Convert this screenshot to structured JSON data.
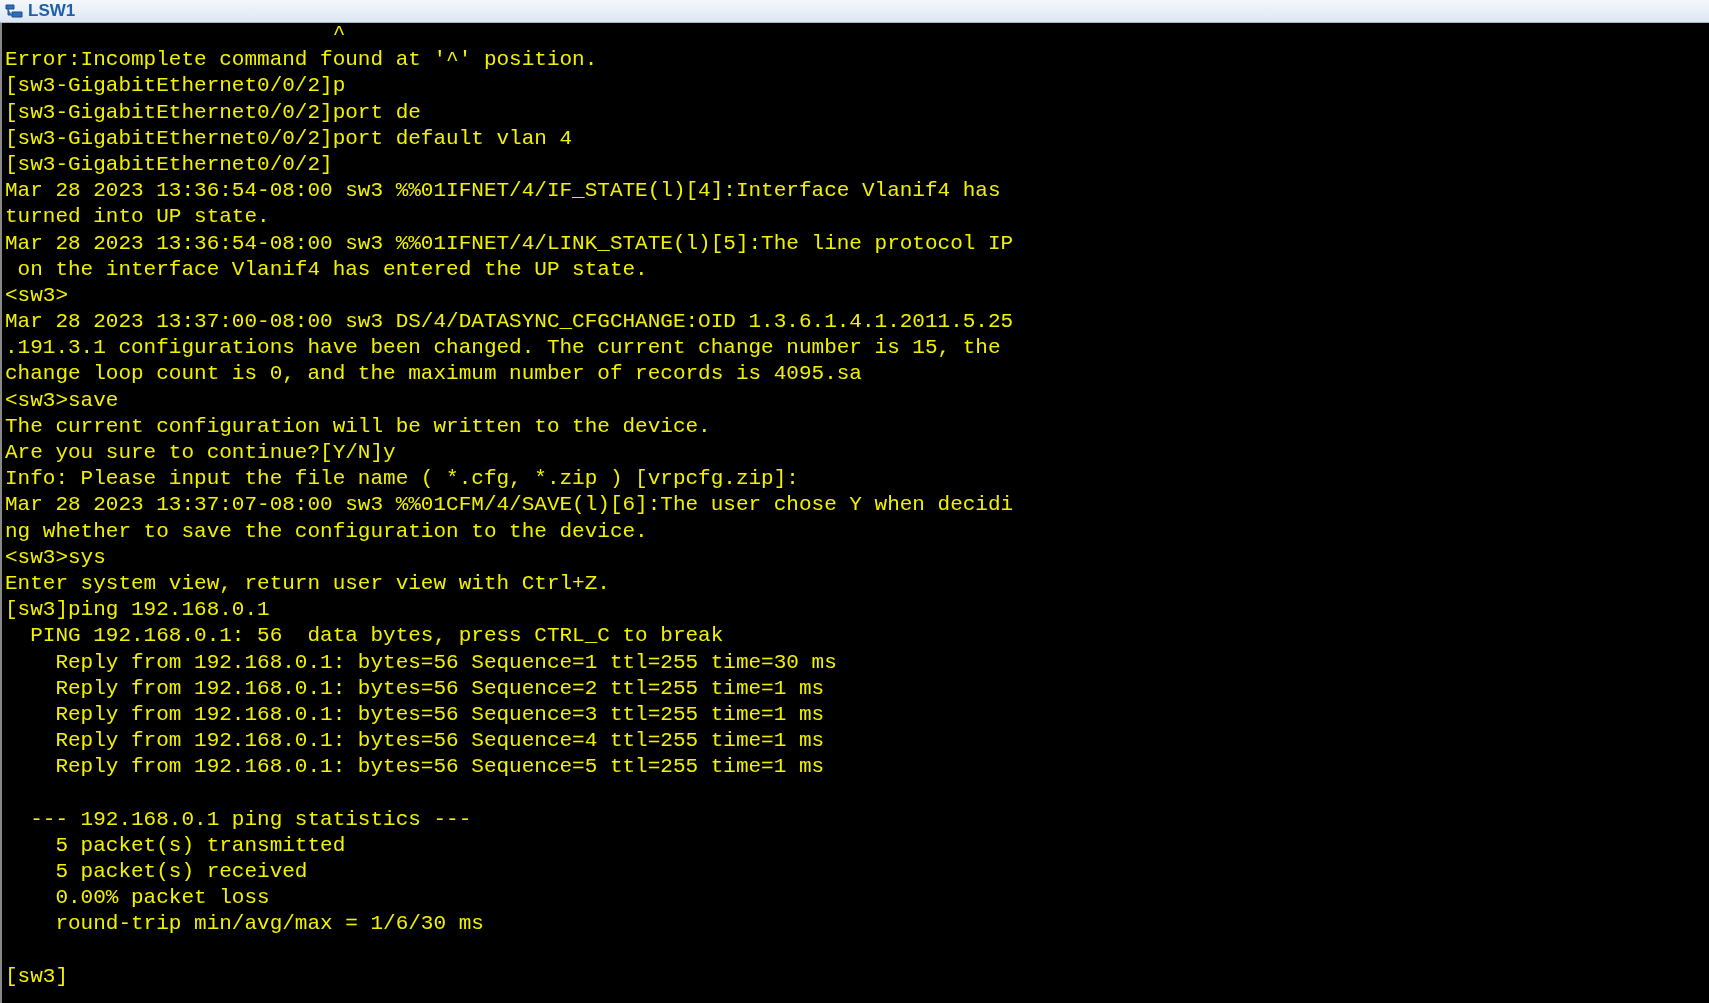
{
  "window": {
    "title": "LSW1"
  },
  "terminal": {
    "lines": [
      {
        "kind": "text",
        "text": "                          ^"
      },
      {
        "kind": "text",
        "text": "Error:Incomplete command found at '^' position."
      },
      {
        "kind": "text",
        "text": "[sw3-GigabitEthernet0/0/2]p"
      },
      {
        "kind": "text",
        "text": "[sw3-GigabitEthernet0/0/2]port de"
      },
      {
        "kind": "text",
        "text": "[sw3-GigabitEthernet0/0/2]port default vlan 4"
      },
      {
        "kind": "text",
        "text": "[sw3-GigabitEthernet0/0/2]"
      },
      {
        "kind": "text",
        "text": "Mar 28 2023 13:36:54-08:00 sw3 %%01IFNET/4/IF_STATE(l)[4]:Interface Vlanif4 has"
      },
      {
        "kind": "text",
        "text": "turned into UP state."
      },
      {
        "kind": "text",
        "text": "Mar 28 2023 13:36:54-08:00 sw3 %%01IFNET/4/LINK_STATE(l)[5]:The line protocol IP"
      },
      {
        "kind": "text",
        "text": " on the interface Vlanif4 has entered the UP state."
      },
      {
        "kind": "text",
        "text": "<sw3>"
      },
      {
        "kind": "text",
        "text": "Mar 28 2023 13:37:00-08:00 sw3 DS/4/DATASYNC_CFGCHANGE:OID 1.3.6.1.4.1.2011.5.25"
      },
      {
        "kind": "text",
        "text": ".191.3.1 configurations have been changed. The current change number is 15, the"
      },
      {
        "kind": "text",
        "text": "change loop count is 0, and the maximum number of records is 4095.sa"
      },
      {
        "kind": "text",
        "text": "<sw3>save"
      },
      {
        "kind": "text",
        "text": "The current configuration will be written to the device."
      },
      {
        "kind": "text",
        "text": "Are you sure to continue?[Y/N]y"
      },
      {
        "kind": "text",
        "text": "Info: Please input the file name ( *.cfg, *.zip ) [vrpcfg.zip]:"
      },
      {
        "kind": "text",
        "text": "Mar 28 2023 13:37:07-08:00 sw3 %%01CFM/4/SAVE(l)[6]:The user chose Y when decidi"
      },
      {
        "kind": "text",
        "text": "ng whether to save the configuration to the device."
      },
      {
        "kind": "text",
        "text": "<sw3>sys"
      },
      {
        "kind": "text",
        "text": "Enter system view, return user view with Ctrl+Z."
      },
      {
        "kind": "text",
        "text": "[sw3]ping 192.168.0.1"
      },
      {
        "kind": "text",
        "text": "  PING 192.168.0.1: 56  data bytes, press CTRL_C to break"
      },
      {
        "kind": "text",
        "text": "    Reply from 192.168.0.1: bytes=56 Sequence=1 ttl=255 time=30 ms"
      },
      {
        "kind": "text",
        "text": "    Reply from 192.168.0.1: bytes=56 Sequence=2 ttl=255 time=1 ms"
      },
      {
        "kind": "text",
        "text": "    Reply from 192.168.0.1: bytes=56 Sequence=3 ttl=255 time=1 ms"
      },
      {
        "kind": "text",
        "text": "    Reply from 192.168.0.1: bytes=56 Sequence=4 ttl=255 time=1 ms"
      },
      {
        "kind": "text",
        "text": "    Reply from 192.168.0.1: bytes=56 Sequence=5 ttl=255 time=1 ms"
      },
      {
        "kind": "blank"
      },
      {
        "kind": "text",
        "text": "  --- 192.168.0.1 ping statistics ---"
      },
      {
        "kind": "text",
        "text": "    5 packet(s) transmitted"
      },
      {
        "kind": "text",
        "text": "    5 packet(s) received"
      },
      {
        "kind": "text",
        "text": "    0.00% packet loss"
      },
      {
        "kind": "text",
        "text": "    round-trip min/avg/max = 1/6/30 ms"
      },
      {
        "kind": "blank"
      },
      {
        "kind": "text",
        "text": "[sw3]"
      }
    ]
  }
}
